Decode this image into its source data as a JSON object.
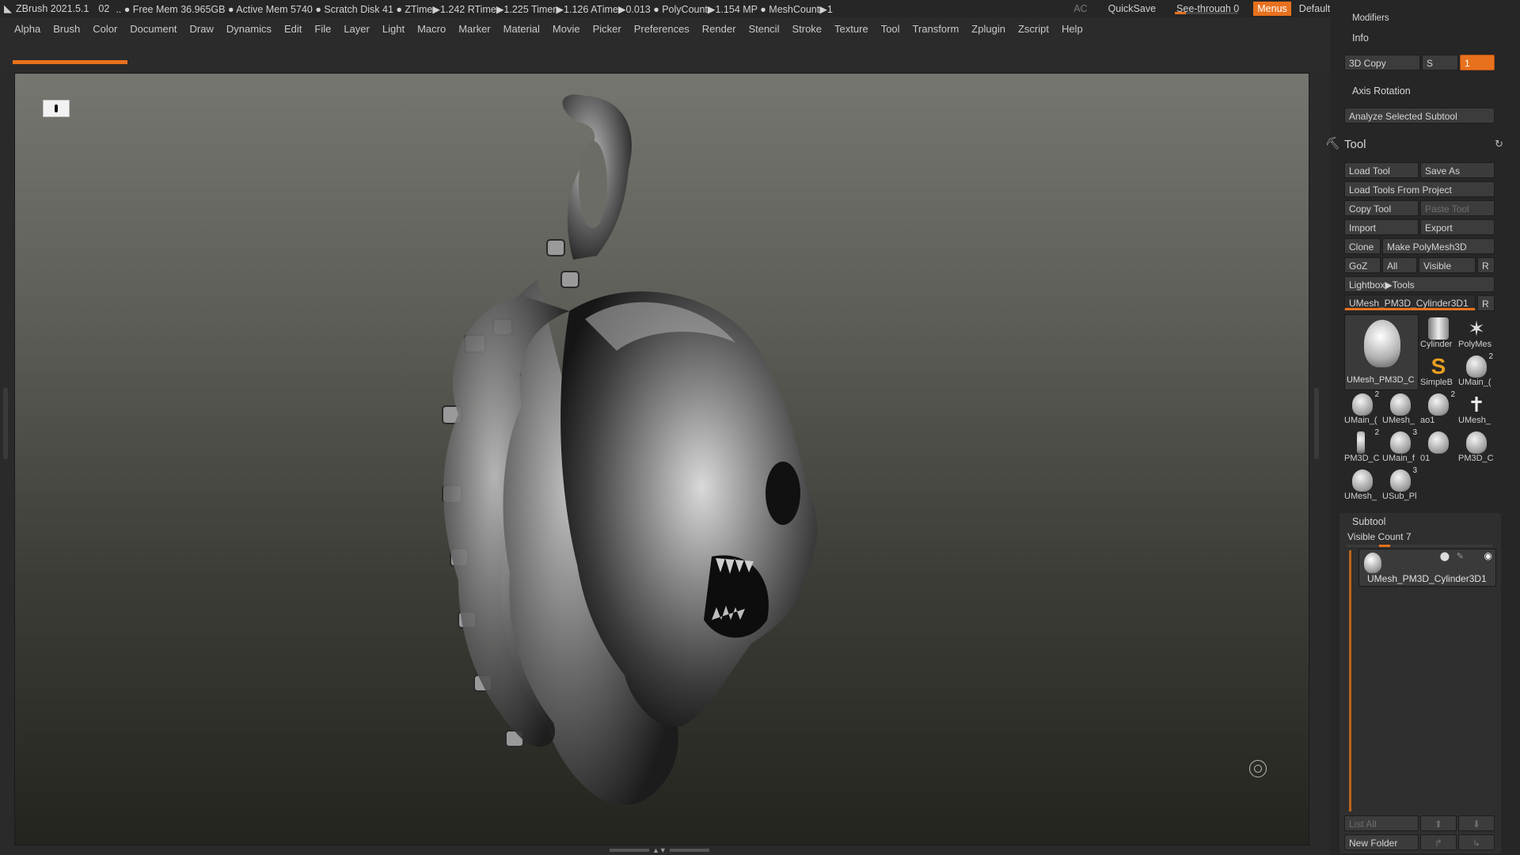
{
  "titlebar": {
    "app": "ZBrush 2021.5.1",
    "doc_num": "02",
    "stats": ".. ● Free Mem 36.965GB ● Active Mem 5740 ● Scratch Disk 41 ●  ZTime▶1.242 RTime▶1.225 Timer▶1.126 ATime▶0.013 ● PolyCount▶1.154 MP  ● MeshCount▶1",
    "ac": "AC",
    "quicksave": "QuickSave",
    "seethrough": "See-through  0",
    "seethrough_value": 0,
    "menus": "Menus",
    "script": "DefaultZScript"
  },
  "menubar": [
    "Alpha",
    "Brush",
    "Color",
    "Document",
    "Draw",
    "Dynamics",
    "Edit",
    "File",
    "Layer",
    "Light",
    "Macro",
    "Marker",
    "Material",
    "Movie",
    "Picker",
    "Preferences",
    "Render",
    "Stencil",
    "Stroke",
    "Texture",
    "Tool",
    "Transform",
    "Zplugin",
    "Zscript",
    "Help"
  ],
  "palette": {
    "modifiers": "Modifiers",
    "info": "Info",
    "copy3d": "3D Copy",
    "s_label": "S",
    "s_value": "1",
    "axis_rotation": "Axis Rotation",
    "analyze": "Analyze Selected Subtool",
    "tool_title": "Tool",
    "load_tool": "Load Tool",
    "save_as": "Save As",
    "load_tools_project": "Load Tools From Project",
    "copy_tool": "Copy Tool",
    "paste_tool": "Paste Tool",
    "import": "Import",
    "export": "Export",
    "clone": "Clone",
    "make_polymesh": "Make PolyMesh3D",
    "goz": "GoZ",
    "all": "All",
    "visible": "Visible",
    "r": "R",
    "lightbox_tools": "Lightbox▶Tools",
    "current_tool": "UMesh_PM3D_Cylinder3D1",
    "tools": [
      {
        "name": "UMesh_PM3D_C",
        "num": ""
      },
      {
        "name": "Cylinder",
        "num": ""
      },
      {
        "name": "PolyMes",
        "num": ""
      },
      {
        "name": "SimpleB",
        "num": ""
      },
      {
        "name": "UMain_(",
        "num": "2"
      },
      {
        "name": "UMain_(",
        "num": "2"
      },
      {
        "name": "UMesh_",
        "num": ""
      },
      {
        "name": "ao1",
        "num": "2"
      },
      {
        "name": "UMesh_",
        "num": ""
      },
      {
        "name": "PM3D_C",
        "num": "2"
      },
      {
        "name": "UMain_f",
        "num": "3"
      },
      {
        "name": "01",
        "num": ""
      },
      {
        "name": "PM3D_C",
        "num": ""
      },
      {
        "name": "UMesh_",
        "num": ""
      },
      {
        "name": "USub_Pl",
        "num": "3"
      }
    ],
    "subtool_title": "Subtool",
    "visible_count": "Visible Count 7",
    "subtool_item": "UMesh_PM3D_Cylinder3D1",
    "list_all": "List All",
    "new_folder": "New Folder"
  }
}
